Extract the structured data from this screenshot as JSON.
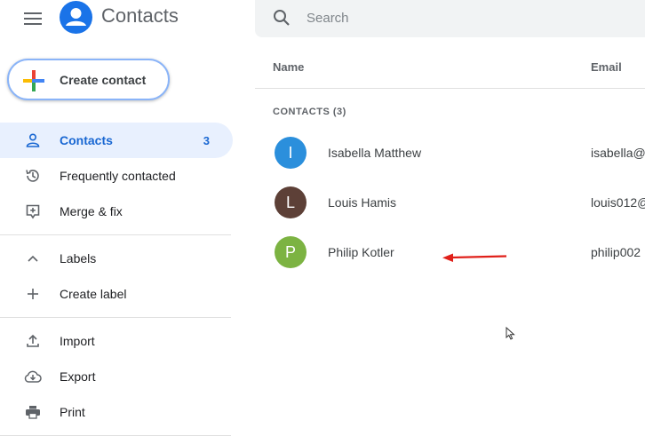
{
  "header": {
    "app_title": "Contacts",
    "search_placeholder": "Search"
  },
  "create_button": {
    "label": "Create contact"
  },
  "sidebar": {
    "items": [
      {
        "label": "Contacts",
        "count": "3",
        "icon": "person-icon",
        "active": true
      },
      {
        "label": "Frequently contacted",
        "icon": "history-icon"
      },
      {
        "label": "Merge & fix",
        "icon": "merge-icon"
      }
    ],
    "labels_section": [
      {
        "label": "Labels",
        "icon": "chevron-up-icon"
      },
      {
        "label": "Create label",
        "icon": "plus-icon"
      }
    ],
    "tools": [
      {
        "label": "Import",
        "icon": "upload-icon"
      },
      {
        "label": "Export",
        "icon": "cloud-download-icon"
      },
      {
        "label": "Print",
        "icon": "printer-icon"
      }
    ]
  },
  "table": {
    "columns": {
      "name": "Name",
      "email": "Email"
    },
    "section_label": "CONTACTS (3)",
    "rows": [
      {
        "initial": "I",
        "name": "Isabella Matthew",
        "email": "isabella@",
        "color": "#2b8fdc"
      },
      {
        "initial": "L",
        "name": "Louis Hamis",
        "email": "louis012@",
        "color": "#5d4037"
      },
      {
        "initial": "P",
        "name": "Philip Kotler",
        "email": "philip002",
        "color": "#7cb342"
      }
    ]
  },
  "colors": {
    "accent": "#1a73e8",
    "active_bg": "#e8f0fe",
    "annotation_arrow": "#e0201a"
  }
}
